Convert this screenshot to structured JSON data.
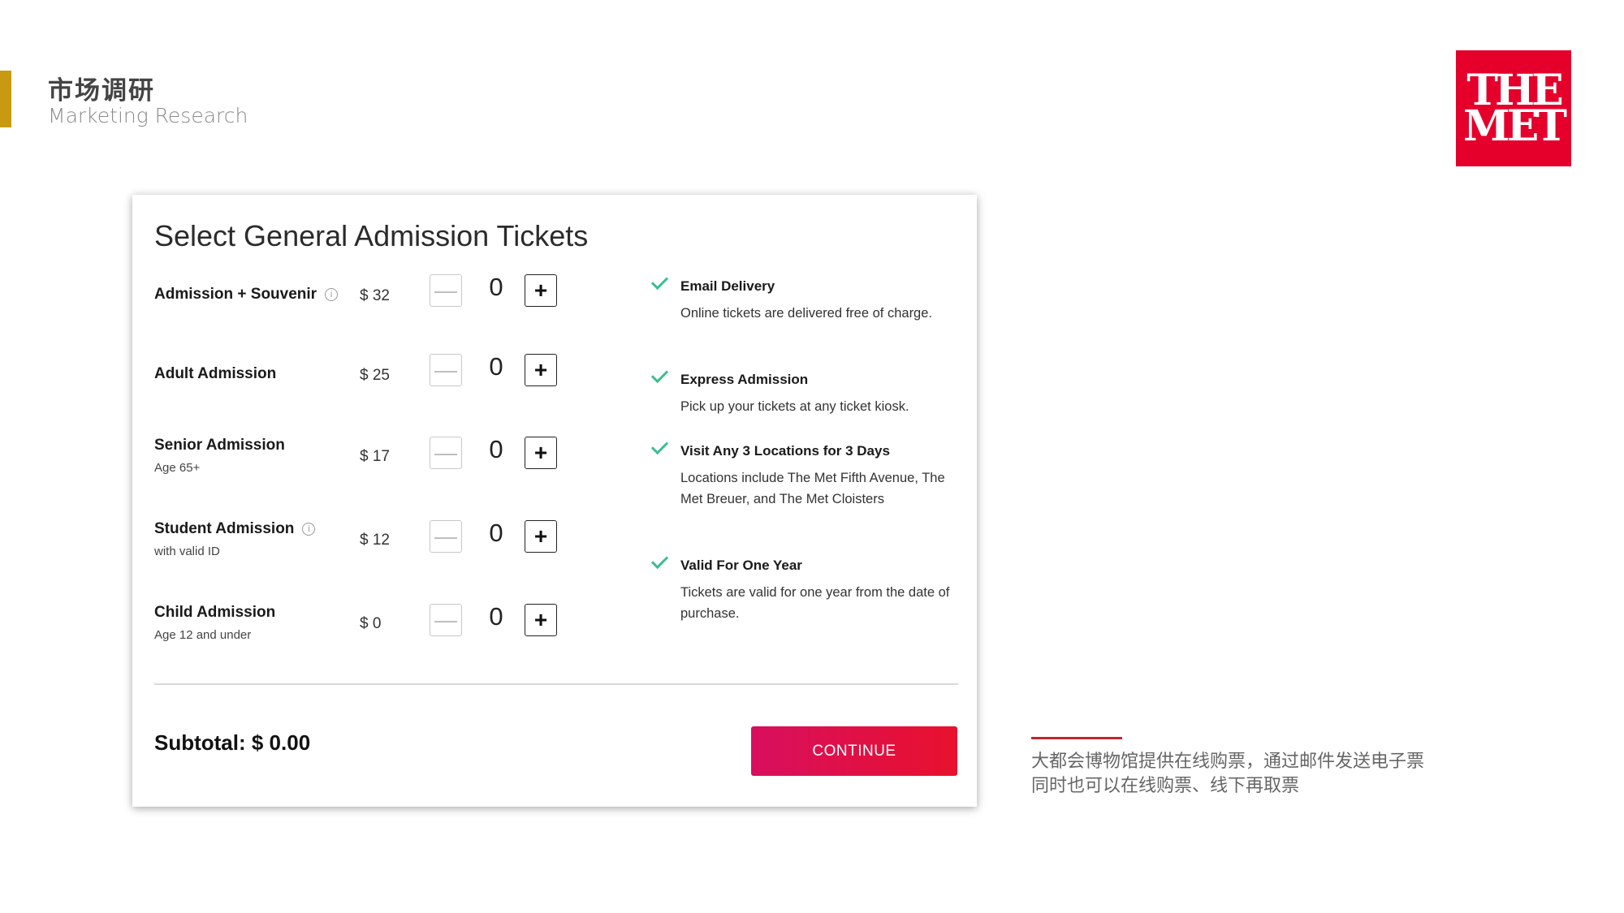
{
  "header": {
    "title": "市场调研",
    "subtitle": "Marketing Research",
    "accent_color": "#c89a12"
  },
  "logo": {
    "line1": "THE",
    "line2": "MET",
    "color": "#e4002b"
  },
  "panel": {
    "title": "Select General Admission Tickets",
    "tickets": [
      {
        "name": "Admission + Souvenir",
        "sub": "",
        "has_info": true,
        "price": "$ 32",
        "qty": "0"
      },
      {
        "name": "Adult Admission",
        "sub": "",
        "has_info": false,
        "price": "$ 25",
        "qty": "0"
      },
      {
        "name": "Senior Admission",
        "sub": "Age 65+",
        "has_info": false,
        "price": "$ 17",
        "qty": "0"
      },
      {
        "name": "Student Admission",
        "sub": "with valid ID",
        "has_info": true,
        "price": "$ 12",
        "qty": "0"
      },
      {
        "name": "Child Admission",
        "sub": "Age 12 and under",
        "has_info": false,
        "price": "$ 0",
        "qty": "0"
      }
    ],
    "minus_symbol": "—",
    "plus_symbol": "+",
    "features": [
      {
        "title": "Email Delivery",
        "desc": "Online tickets are delivered free of charge."
      },
      {
        "title": "Express Admission",
        "desc": "Pick up your tickets at any ticket kiosk."
      },
      {
        "title": "Visit Any 3 Locations for 3 Days",
        "desc": "Locations include The Met Fifth Avenue, The Met Breuer, and The Met Cloisters"
      },
      {
        "title": "Valid For One Year",
        "desc": "Tickets are valid for one year from the date of purchase."
      }
    ],
    "subtotal": "Subtotal: $ 0.00",
    "continue_label": "CONTINUE"
  },
  "caption": {
    "line1": "大都会博物馆提供在线购票，通过邮件发送电子票",
    "line2": "同时也可以在线购票、线下再取票"
  }
}
